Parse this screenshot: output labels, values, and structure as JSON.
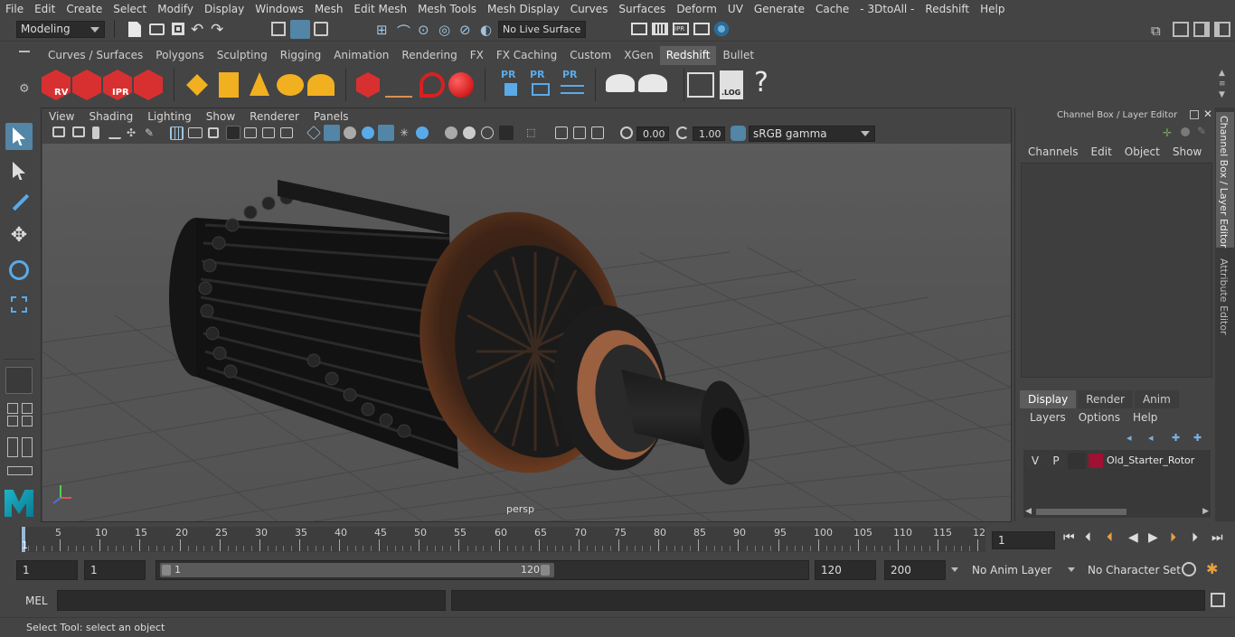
{
  "menubar": {
    "items": [
      "File",
      "Edit",
      "Create",
      "Select",
      "Modify",
      "Display",
      "Windows",
      "Mesh",
      "Edit Mesh",
      "Mesh Tools",
      "Mesh Display",
      "Curves",
      "Surfaces",
      "Deform",
      "UV",
      "Generate",
      "Cache",
      "- 3DtoAll -",
      "Redshift",
      "Help"
    ]
  },
  "status": {
    "mode": "Modeling",
    "live_surface": "No Live Surface"
  },
  "shelf": {
    "tabs": [
      "Curves / Surfaces",
      "Polygons",
      "Sculpting",
      "Rigging",
      "Animation",
      "Rendering",
      "FX",
      "FX Caching",
      "Custom",
      "XGen",
      "Redshift",
      "Bullet"
    ],
    "active": "Redshift",
    "icon_labels": {
      "rv": "RV",
      "ipr": "IPR",
      "pr": "PR",
      "log": ".LOG",
      "help": "?"
    }
  },
  "viewport": {
    "menus": [
      "View",
      "Shading",
      "Lighting",
      "Show",
      "Renderer",
      "Panels"
    ],
    "exposure": "0.00",
    "gamma": "1.00",
    "colorspace": "sRGB gamma",
    "camera_label": "persp"
  },
  "channel_box": {
    "title": "Channel Box / Layer Editor",
    "menus": [
      "Channels",
      "Edit",
      "Object",
      "Show"
    ],
    "layer_tabs": [
      "Display",
      "Render",
      "Anim"
    ],
    "layer_menus": [
      "Layers",
      "Options",
      "Help"
    ],
    "layer": {
      "v": "V",
      "p": "P",
      "name": "Old_Starter_Rotor",
      "color": "#a01030"
    }
  },
  "side_tabs": {
    "channel": "Channel Box / Layer Editor",
    "attribute": "Attribute Editor"
  },
  "timeline": {
    "ticks": [
      "5",
      "10",
      "15",
      "20",
      "25",
      "30",
      "35",
      "40",
      "45",
      "50",
      "55",
      "60",
      "65",
      "70",
      "75",
      "80",
      "85",
      "90",
      "95",
      "100",
      "105",
      "110",
      "115",
      "12"
    ],
    "start_marker": "1",
    "current_frame": "1"
  },
  "range": {
    "start": "1",
    "playback_start": "1",
    "slider_start": "1",
    "slider_end": "120",
    "end": "120",
    "anim_end": "200",
    "anim_layer": "No Anim Layer",
    "char_set": "No Character Set"
  },
  "command": {
    "label": "MEL"
  },
  "help": {
    "text": "Select Tool: select an object"
  }
}
